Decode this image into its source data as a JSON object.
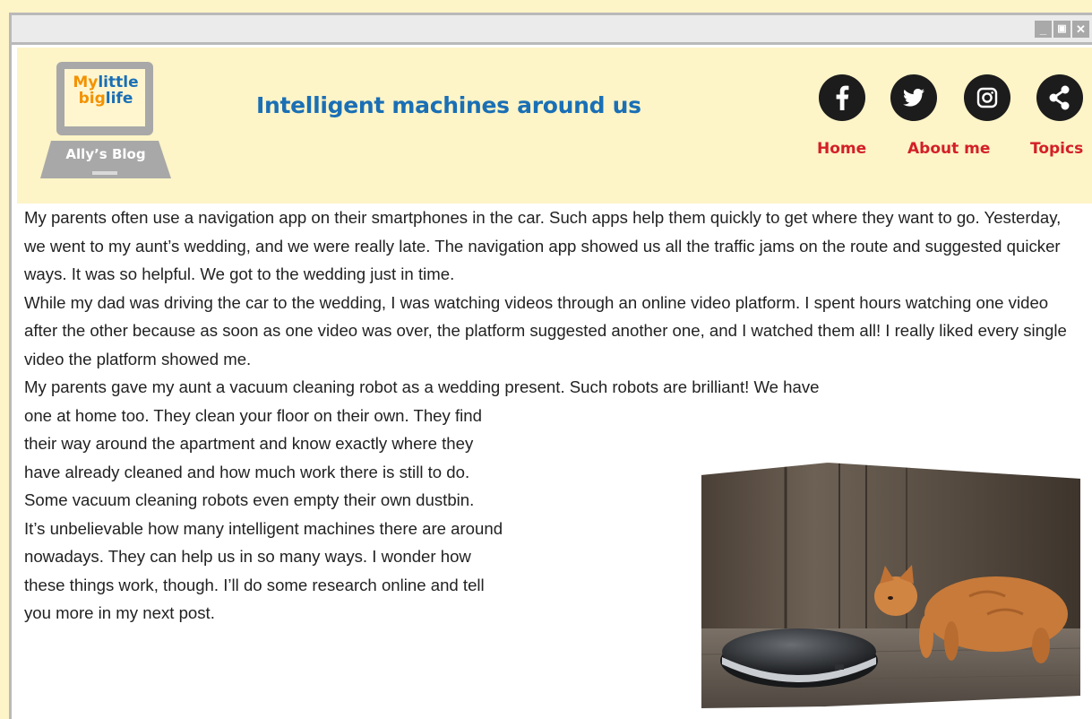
{
  "window": {
    "controls": [
      "_",
      "▣",
      "✕"
    ]
  },
  "header": {
    "logo": {
      "line1a": "My",
      "line1b": "little",
      "line2a": "big",
      "line2b": "life",
      "caption": "Ally’s Blog"
    },
    "title": "Intelligent machines around us",
    "social_icons": [
      "facebook-icon",
      "twitter-icon",
      "instagram-icon",
      "share-icon"
    ],
    "nav": {
      "home": "Home",
      "about": "About me",
      "topics": "Topics"
    }
  },
  "post": {
    "paragraph1": "My parents often use a navigation app on their smartphones in the car. Such apps help them quickly to get where they want to go. Yesterday, we went to my aunt’s wedding, and we were really late. The navigation app showed us all the traffic jams on the route and suggested quicker ways. It was so helpful. We got to the wedding just in time.",
    "paragraph2": "While my dad was driving the car to the wedding, I was watching videos through an online video platform. I spent hours watching one video after the other because as soon as one video was over, the platform suggested another one, and I watched them all! I really liked every single video the platform showed me.",
    "paragraph3_line1": "My parents gave my aunt a vacuum cleaning robot as a wedding present. Such robots are brilliant! We have",
    "paragraph3_lines": [
      "one at home too. They clean your floor on their own. They find",
      "their way around the apartment and know exactly where they",
      "have already cleaned and how much work there is still to do.",
      "Some vacuum cleaning robots even empty their own dustbin.",
      "It’s unbelievable how many intelligent machines there are around",
      "nowadays. They can help us in so many ways. I wonder how",
      "these things work, though. I’ll do some research online and tell",
      "you more in my next post."
    ]
  },
  "photo": {
    "subject": "cat-and-robot-vacuum-photo"
  },
  "colors": {
    "page_bg": "#fdf4c7",
    "title_blue": "#1a6fb5",
    "nav_red": "#d32027",
    "logo_orange": "#f39200",
    "logo_blue": "#1a6fb5",
    "social_dark": "#1c1c1c"
  }
}
